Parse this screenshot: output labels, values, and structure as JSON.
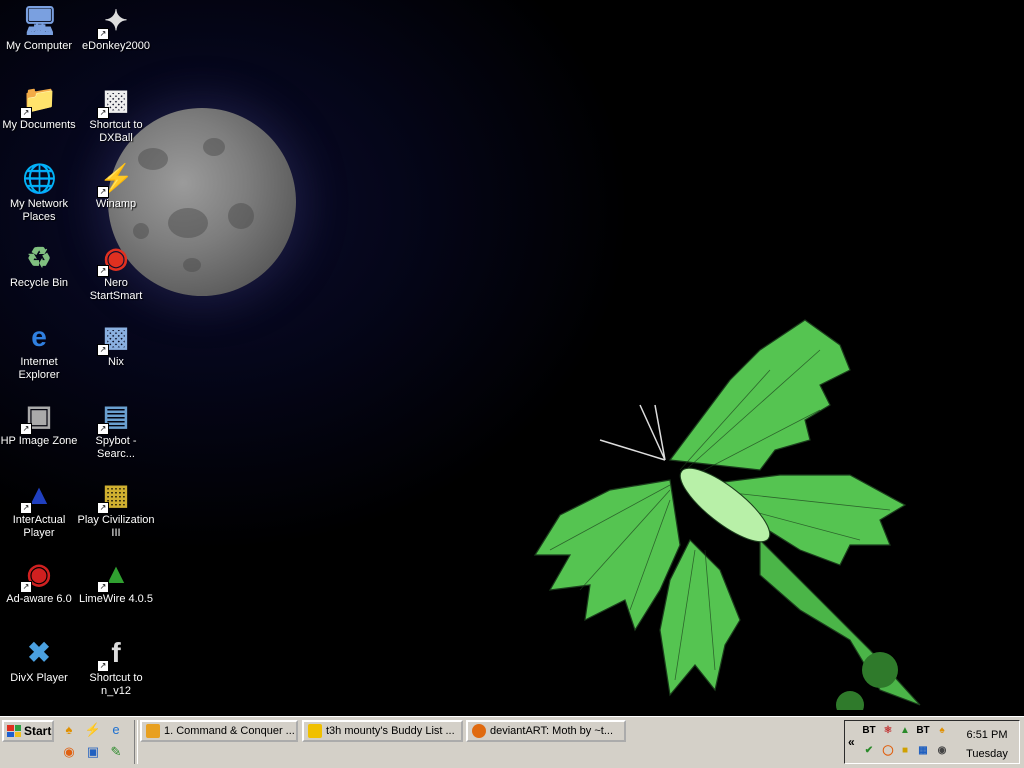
{
  "desktop": {
    "icons": [
      {
        "label": "My Computer",
        "icon": "computer-icon",
        "shortcut": false
      },
      {
        "label": "eDonkey2000",
        "icon": "edonkey-icon",
        "shortcut": true
      },
      {
        "label": "My Documents",
        "icon": "folder-icon",
        "shortcut": true
      },
      {
        "label": "Shortcut to DXBall",
        "icon": "dxball-icon",
        "shortcut": true
      },
      {
        "label": "My Network Places",
        "icon": "network-icon",
        "shortcut": false
      },
      {
        "label": "Winamp",
        "icon": "winamp-icon",
        "shortcut": true
      },
      {
        "label": "Recycle Bin",
        "icon": "recycle-bin-icon",
        "shortcut": false
      },
      {
        "label": "Nero StartSmart",
        "icon": "nero-icon",
        "shortcut": true
      },
      {
        "label": "Internet Explorer",
        "icon": "ie-icon",
        "shortcut": false
      },
      {
        "label": "Nix",
        "icon": "nix-icon",
        "shortcut": true
      },
      {
        "label": "HP Image Zone",
        "icon": "hp-image-icon",
        "shortcut": true
      },
      {
        "label": "Spybot - Searc...",
        "icon": "spybot-icon",
        "shortcut": true
      },
      {
        "label": "InterActual Player",
        "icon": "interactual-icon",
        "shortcut": true
      },
      {
        "label": "Play Civilization III",
        "icon": "civ3-icon",
        "shortcut": true
      },
      {
        "label": "Ad-aware 6.0",
        "icon": "adaware-icon",
        "shortcut": true
      },
      {
        "label": "LimeWire 4.0.5",
        "icon": "limewire-icon",
        "shortcut": true
      },
      {
        "label": "DivX Player",
        "icon": "divx-icon",
        "shortcut": false
      },
      {
        "label": "Shortcut to n_v12",
        "icon": "flash-icon",
        "shortcut": true
      }
    ]
  },
  "taskbar": {
    "start_label": "Start",
    "quick_launch": [
      "aim-icon",
      "winamp-icon",
      "ie-icon",
      "firefox-icon",
      "desktop-icon",
      "notepad-icon"
    ],
    "tasks": [
      {
        "label": "1. Command & Conquer ...",
        "icon_color": "#e8a020"
      },
      {
        "label": "t3h mounty's Buddy List ...",
        "icon_color": "#f0c000"
      },
      {
        "label": "deviantART: Moth by ~t...",
        "icon_color": "#e06a10"
      }
    ],
    "tray": {
      "chevron": "«",
      "bt_label": "BT",
      "time": "6:51 PM",
      "day": "Tuesday"
    }
  },
  "colors": {
    "moth_green": "#5fd35a",
    "moth_dark": "#1f6a24",
    "taskbar": "#d4d0c8"
  }
}
